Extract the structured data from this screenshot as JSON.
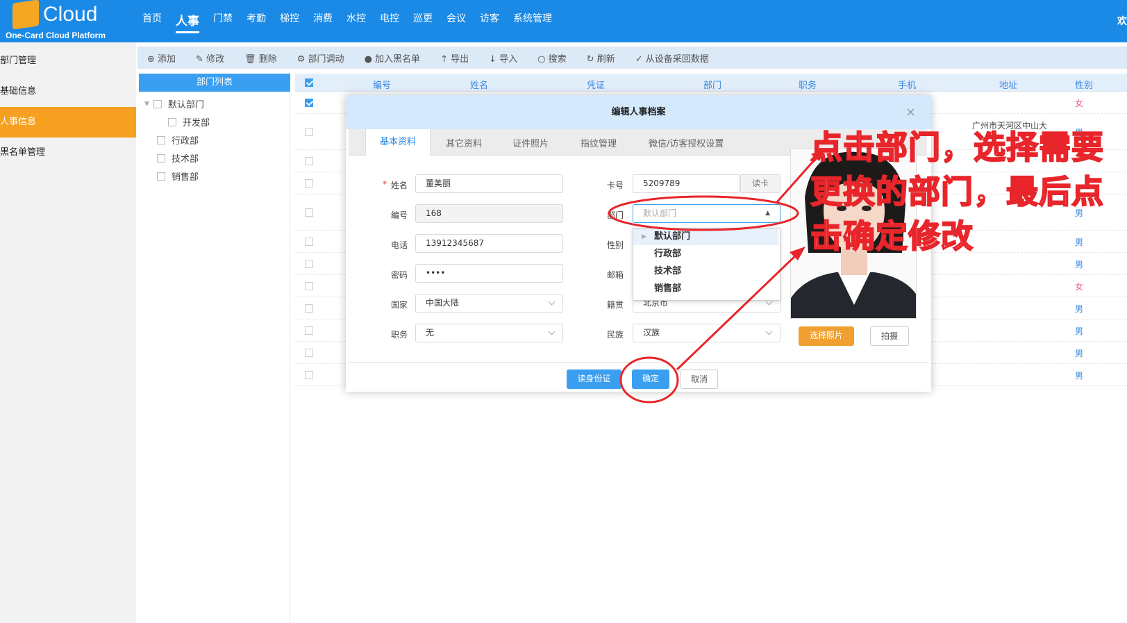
{
  "header": {
    "brand": "Cloud",
    "subtitle": "One-Card Cloud Platform",
    "nav": [
      "首页",
      "人事",
      "门禁",
      "考勤",
      "梯控",
      "消费",
      "水控",
      "电控",
      "巡更",
      "会议",
      "访客",
      "系统管理"
    ],
    "nav_active": "人事",
    "welcome": "欢"
  },
  "sidebar": {
    "items": [
      {
        "label": "部门管理"
      },
      {
        "label": "基础信息"
      },
      {
        "label": "人事信息",
        "active": true
      },
      {
        "label": "黑名单管理"
      }
    ]
  },
  "toolbar": {
    "items": [
      {
        "icon": "plus-circle-icon",
        "label": "添加"
      },
      {
        "icon": "pencil-icon",
        "label": "修改"
      },
      {
        "icon": "trash-icon",
        "label": "删除"
      },
      {
        "icon": "transfer-icon",
        "label": "部门调动"
      },
      {
        "icon": "blacklist-icon",
        "label": "加入黑名单"
      },
      {
        "icon": "arrow-up-icon",
        "label": "导出"
      },
      {
        "icon": "arrow-down-icon",
        "label": "导入"
      },
      {
        "icon": "search-icon",
        "label": "搜索"
      },
      {
        "icon": "refresh-icon",
        "label": "刷新"
      },
      {
        "icon": "check-icon",
        "label": "从设备采回数据"
      }
    ]
  },
  "dept_tree": {
    "title": "部门列表",
    "items": [
      "默认部门",
      "开发部",
      "行政部",
      "技术部",
      "销售部"
    ]
  },
  "table": {
    "columns": [
      "编号",
      "姓名",
      "凭证",
      "部门",
      "职务",
      "手机",
      "地址",
      "性别"
    ],
    "address_visible": "广州市天河区中山大",
    "sex_values": [
      "女",
      "男",
      "男",
      "男",
      "男",
      "男",
      "女",
      "男",
      "男",
      "男",
      "男"
    ]
  },
  "modal": {
    "title": "编辑人事档案",
    "close": "×",
    "tabs": [
      "基本资料",
      "其它资料",
      "证件照片",
      "指纹管理",
      "微信/访客授权设置"
    ],
    "active_tab": "基本资料",
    "fields": {
      "name_label": "姓名",
      "name": "董美丽",
      "no_label": "编号",
      "no": "168",
      "phone_label": "电话",
      "phone": "13912345687",
      "pwd_label": "密码",
      "pwd": "••••",
      "country_label": "国家",
      "country": "中国大陆",
      "post_label": "职务",
      "post": "无",
      "card_label": "卡号",
      "card": "5209789",
      "read_card": "读卡",
      "dept_label": "部门",
      "dept_placeholder": "默认部门",
      "sex_label": "性别",
      "email_label": "邮箱",
      "native_label": "籍贯",
      "native": "北京市",
      "nation_label": "民族",
      "nation": "汉族"
    },
    "dept_options": [
      "默认部门",
      "行政部",
      "技术部",
      "销售部"
    ],
    "photo_buttons": {
      "select": "选择照片",
      "capture": "拍摄"
    },
    "footer": {
      "read_id": "读身份证",
      "ok": "确定",
      "cancel": "取消"
    }
  },
  "annotation": {
    "text": "点击部门，选择需要更换的部门，最后点击确定修改",
    "color": "#e8252a"
  }
}
